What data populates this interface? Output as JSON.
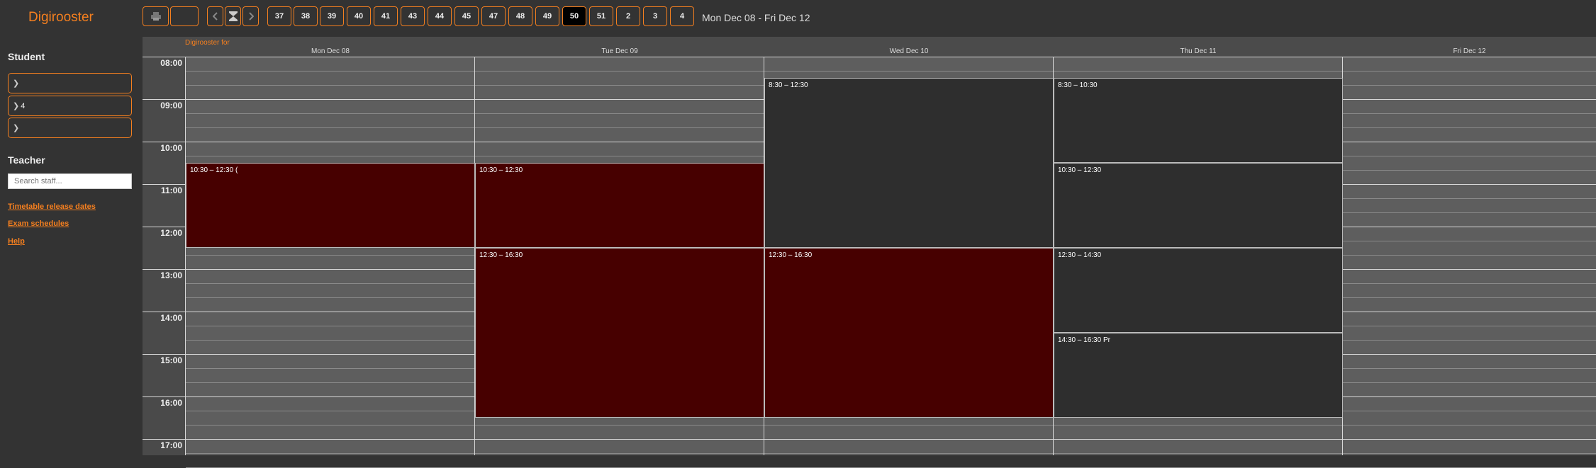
{
  "app": {
    "title": "Digirooster",
    "brand_sub": "Digirooster for"
  },
  "toolbar": {
    "print_icon": "printer-icon",
    "prev_icon": "chevron-left-icon",
    "today_icon": "hourglass-icon",
    "next_icon": "chevron-right-icon",
    "weeks": [
      "37",
      "38",
      "39",
      "40",
      "41",
      "43",
      "44",
      "45",
      "47",
      "48",
      "49",
      "50",
      "51",
      "2",
      "3",
      "4"
    ],
    "active_week": "50",
    "date_range": "Mon Dec 08 - Fri Dec 12"
  },
  "sidebar": {
    "student_heading": "Student",
    "selects": [
      "",
      "4",
      ""
    ],
    "teacher_heading": "Teacher",
    "staff_placeholder": "Search staff...",
    "links": [
      "Timetable release dates",
      "Exam schedules",
      "Help"
    ]
  },
  "calendar": {
    "days": [
      "Mon Dec 08",
      "Tue Dec 09",
      "Wed Dec 10",
      "Thu Dec 11",
      "Fri Dec 12"
    ],
    "hours": [
      "08:00",
      "09:00",
      "10:00",
      "11:00",
      "12:00",
      "13:00",
      "14:00",
      "15:00",
      "16:00",
      "17:00"
    ],
    "events": [
      {
        "day": 0,
        "start": 10.5,
        "end": 12.5,
        "label": "10:30 – 12:30 (",
        "color": "red"
      },
      {
        "day": 1,
        "start": 10.5,
        "end": 12.5,
        "label": "10:30 – 12:30",
        "color": "red"
      },
      {
        "day": 1,
        "start": 12.5,
        "end": 16.5,
        "label": "12:30 – 16:30",
        "color": "red"
      },
      {
        "day": 2,
        "start": 8.5,
        "end": 12.5,
        "label": "8:30 – 12:30",
        "color": "dark"
      },
      {
        "day": 2,
        "start": 12.5,
        "end": 16.5,
        "label": "12:30 – 16:30",
        "color": "red"
      },
      {
        "day": 3,
        "start": 8.5,
        "end": 10.5,
        "label": "8:30 – 10:30",
        "color": "dark"
      },
      {
        "day": 3,
        "start": 10.5,
        "end": 12.5,
        "label": "10:30 – 12:30",
        "color": "dark"
      },
      {
        "day": 3,
        "start": 12.5,
        "end": 14.5,
        "label": "12:30 – 14:30",
        "color": "dark"
      },
      {
        "day": 3,
        "start": 14.5,
        "end": 16.5,
        "label": "14:30 – 16:30 Pr",
        "color": "dark"
      }
    ],
    "colors": {
      "red": "#470000",
      "dark": "#2e2e2e",
      "accent": "#f47f1f"
    }
  }
}
